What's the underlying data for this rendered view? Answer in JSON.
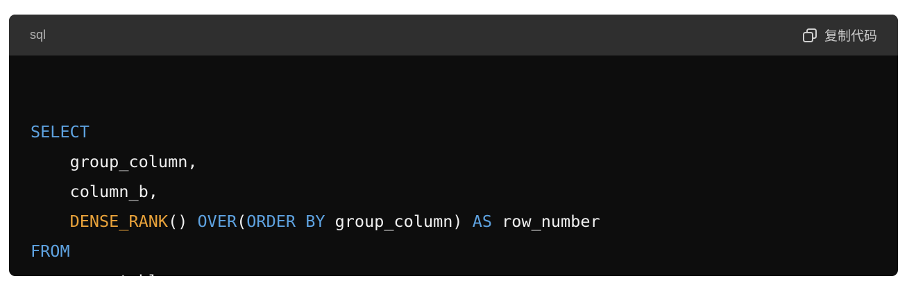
{
  "code_block": {
    "language": "sql",
    "copy_label": "复制代码",
    "copy_icon": "copy-icon",
    "colors": {
      "header_bg": "#2f2f2f",
      "body_bg": "#0d0d0d",
      "keyword": "#5ea2e0",
      "function": "#e8a23a",
      "text": "#f0f0f0"
    },
    "lines": [
      [
        {
          "t": "SELECT",
          "k": "kw"
        }
      ],
      [
        {
          "t": "    group_column,",
          "k": ""
        }
      ],
      [
        {
          "t": "    column_b,",
          "k": ""
        }
      ],
      [
        {
          "t": "    ",
          "k": ""
        },
        {
          "t": "DENSE_RANK",
          "k": "fn"
        },
        {
          "t": "() ",
          "k": ""
        },
        {
          "t": "OVER",
          "k": "kw"
        },
        {
          "t": "(",
          "k": ""
        },
        {
          "t": "ORDER",
          "k": "kw"
        },
        {
          "t": " ",
          "k": ""
        },
        {
          "t": "BY",
          "k": "kw"
        },
        {
          "t": " group_column) ",
          "k": ""
        },
        {
          "t": "AS",
          "k": "kw"
        },
        {
          "t": " row_number",
          "k": ""
        }
      ],
      [
        {
          "t": "FROM",
          "k": "kw"
        }
      ],
      [
        {
          "t": "    your_table;",
          "k": ""
        }
      ]
    ]
  }
}
